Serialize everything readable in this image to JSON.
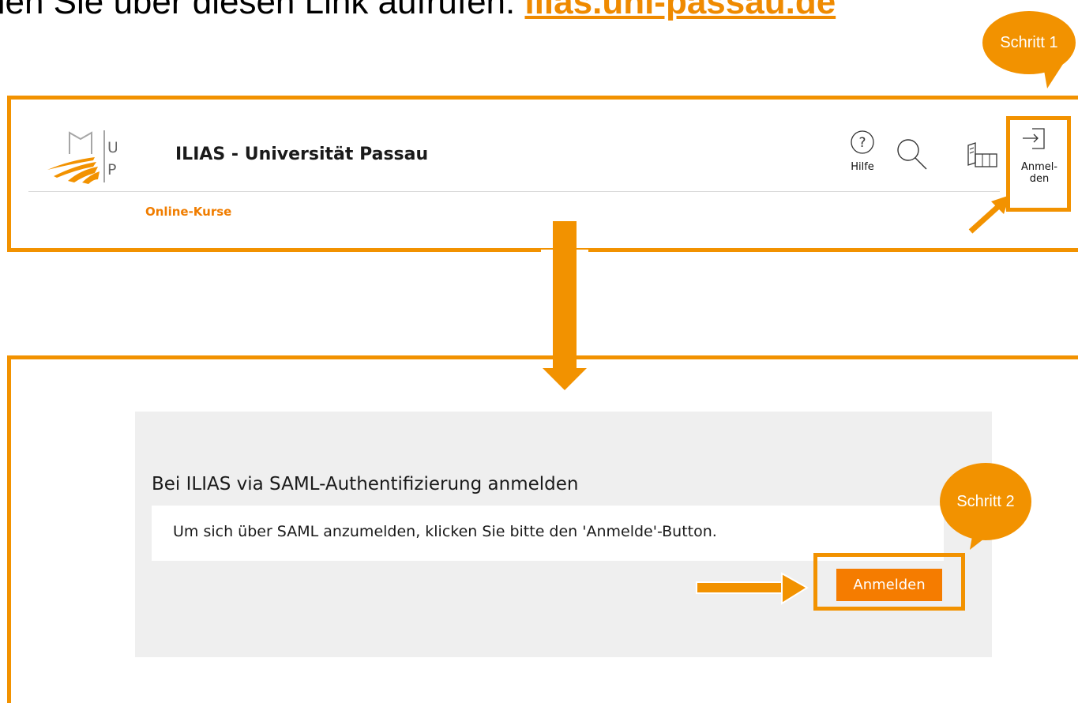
{
  "intro": {
    "text_prefix": "hen Sie über diesen Link aufrufen: ",
    "link_text": "ilias.uni-passau.de"
  },
  "callouts": {
    "step1": "Schritt 1",
    "step2": "Schritt 2"
  },
  "header": {
    "logo_letters": [
      "U",
      "P"
    ],
    "title": "ILIAS - Universität Passau",
    "help_label": "Hilfe",
    "login_label_line1": "Anmel-",
    "login_label_line2": "den",
    "nav": [
      "Online-Kurse"
    ],
    "icons": [
      "help-icon",
      "search-icon",
      "map-icon",
      "login-icon"
    ]
  },
  "login_form": {
    "heading": "Bei ILIAS via SAML-Authentifizierung anmelden",
    "message": "Um sich über SAML anzumelden, klicken Sie bitte den 'Anmelde'-Button.",
    "button_label": "Anmelden"
  },
  "colors": {
    "accent": "#f29200",
    "button": "#f57c00",
    "nav_link": "#f07d00",
    "form_bg": "#efefef"
  }
}
